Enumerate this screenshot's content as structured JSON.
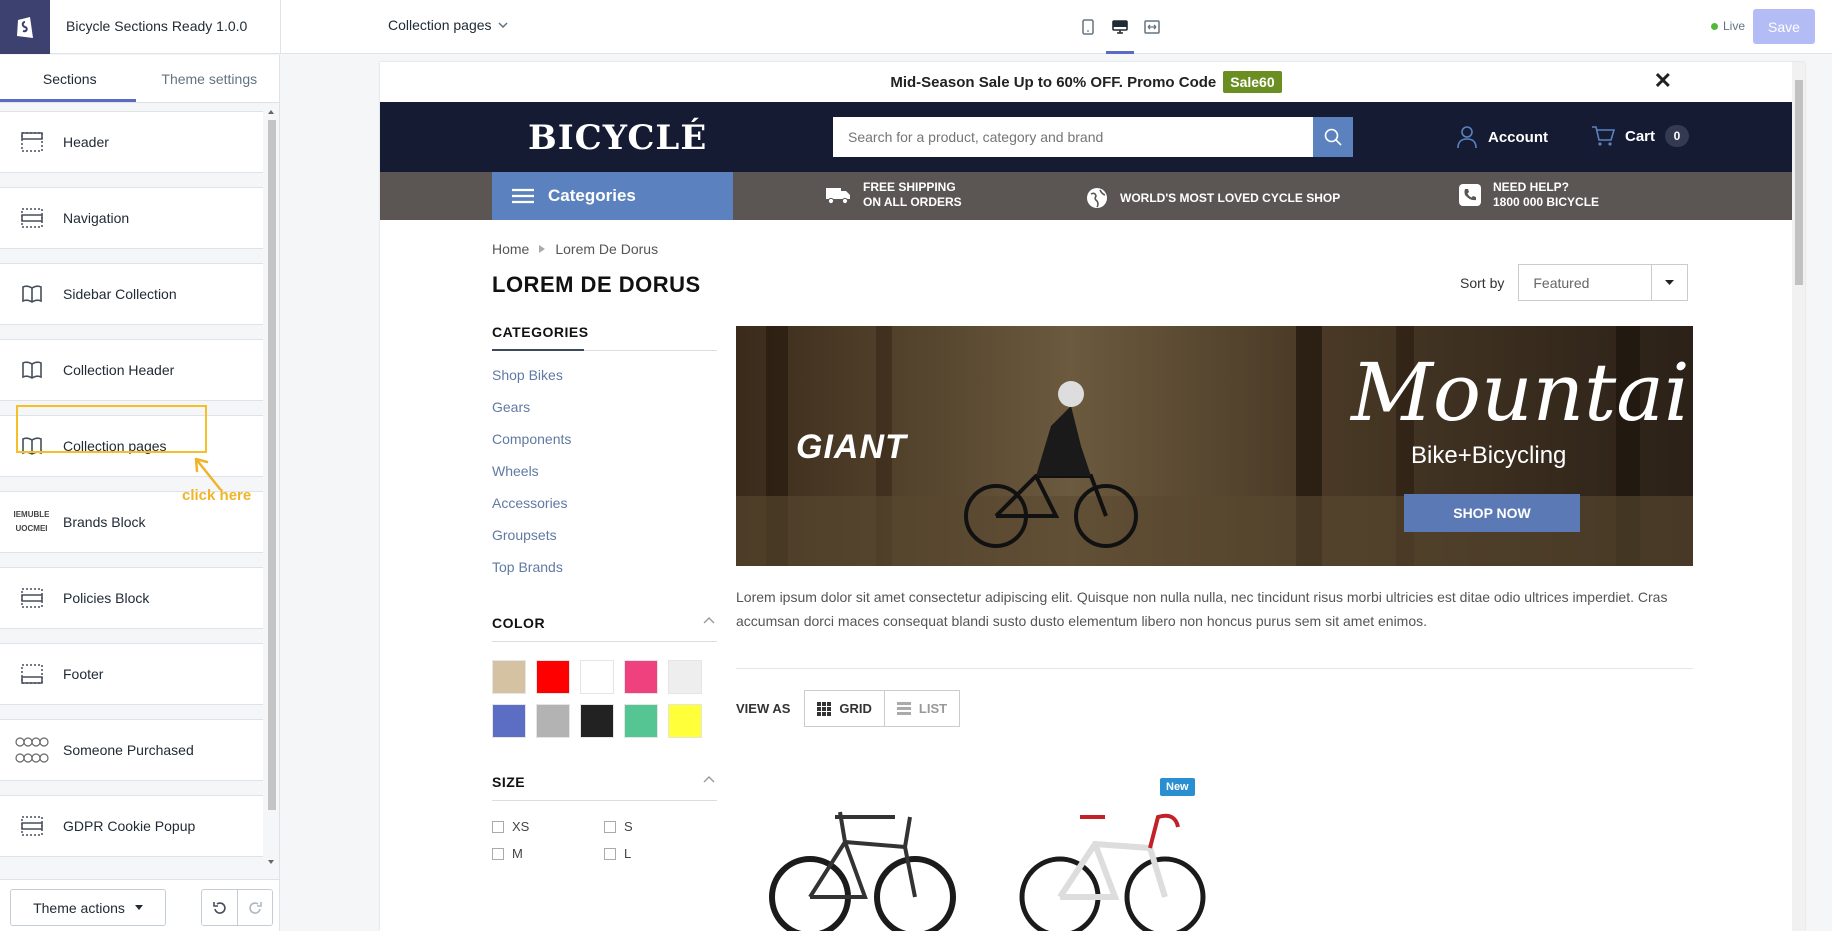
{
  "app": {
    "title": "Bicycle Sections Ready 1.0.0",
    "page_select": "Collection pages",
    "live_label": "Live",
    "save_label": "Save"
  },
  "sidebar": {
    "tabs": [
      {
        "label": "Sections"
      },
      {
        "label": "Theme settings"
      }
    ],
    "sections": [
      {
        "label": "Header",
        "icon": "section-icon"
      },
      {
        "label": "Navigation",
        "icon": "section-icon"
      },
      {
        "label": "Sidebar Collection",
        "icon": "book-icon"
      },
      {
        "label": "Collection Header",
        "icon": "book-icon"
      },
      {
        "label": "Collection pages",
        "icon": "book-icon"
      },
      {
        "label": "Brands Block",
        "icon": "brands-thumbnail-icon"
      },
      {
        "label": "Policies Block",
        "icon": "section-icon"
      },
      {
        "label": "Footer",
        "icon": "section-icon"
      },
      {
        "label": "Someone Purchased",
        "icon": "bikes-thumbnail-icon"
      },
      {
        "label": "GDPR Cookie Popup",
        "icon": "section-icon"
      }
    ],
    "annotation": "click here",
    "theme_actions": "Theme actions",
    "brand_thumb_text": [
      "IEMUBLE",
      "UOCMEI"
    ]
  },
  "preview": {
    "promo": {
      "text": "Mid-Season Sale Up to 60% OFF. Promo Code",
      "code": "Sale60",
      "close": "✕"
    },
    "brand": "BICYCLÉ",
    "search_placeholder": "Search for a product, category and brand",
    "account": "Account",
    "cart": {
      "label": "Cart",
      "count": "0"
    },
    "categories": "Categories",
    "features": [
      {
        "line1": "FREE SHIPPING",
        "line2": "ON ALL ORDERS",
        "icon": "truck-icon"
      },
      {
        "line1": "WORLD'S MOST LOVED CYCLE SHOP",
        "line2": "",
        "icon": "globe-icon"
      },
      {
        "line1": "NEED HELP?",
        "line2": "1800 000 BICYCLE",
        "icon": "phone-icon"
      }
    ],
    "breadcrumb": [
      "Home",
      "Lorem De Dorus"
    ],
    "page_title": "LOREM DE DORUS",
    "sort": {
      "label": "Sort by",
      "value": "Featured"
    },
    "filters": {
      "categories_title": "CATEGORIES",
      "categories": [
        "Shop Bikes",
        "Gears",
        "Components",
        "Wheels",
        "Accessories",
        "Groupsets",
        "Top Brands"
      ],
      "color_title": "COLOR",
      "colors": [
        "#d4c2a3",
        "#ff0000",
        "#ffffff",
        "#f0417f",
        "#eeeeee",
        "#5b6ec3",
        "#b3b3b3",
        "#222222",
        "#55c594",
        "#ffff3a"
      ],
      "size_title": "SIZE",
      "sizes": [
        "XS",
        "S",
        "M",
        "L"
      ]
    },
    "banner": {
      "brand": "GIANT",
      "headline": "Mountain",
      "subline": "Bike+Bicycling",
      "cta": "SHOP NOW"
    },
    "description": "Lorem ipsum dolor sit amet consectetur adipiscing elit. Quisque non nulla nulla, nec tincidunt risus morbi ultricies est ditae odio ultrices imperdiet. Cras accumsan dorci maces consequat blandi susto dusto elementum libero non honcus purus sem sit amet enimos.",
    "view_as": {
      "label": "VIEW AS",
      "grid": "GRID",
      "list": "LIST"
    },
    "badge": "New"
  }
}
